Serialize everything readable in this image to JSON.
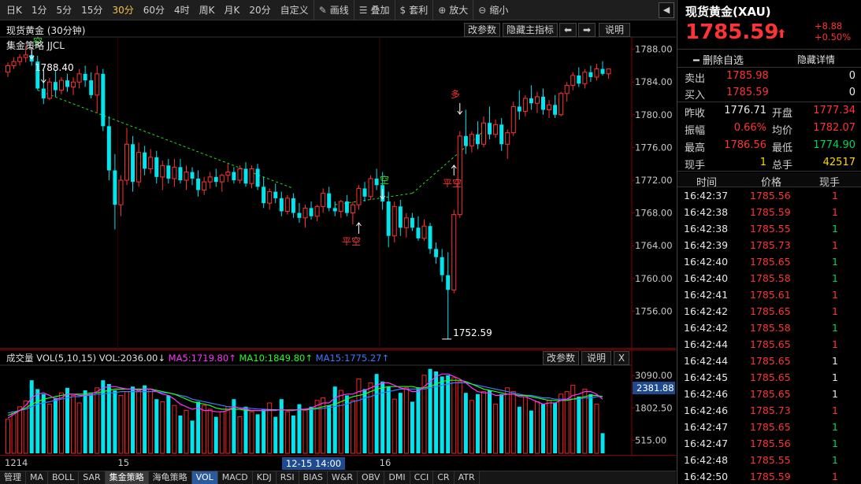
{
  "toolbar": {
    "items": [
      "日K",
      "1分",
      "5分",
      "15分",
      "30分",
      "60分",
      "4时",
      "周K",
      "月K",
      "20分",
      "自定义"
    ],
    "active": "30分",
    "tools": [
      {
        "icon": "pencil-icon",
        "glyph": "✎",
        "label": "画线"
      },
      {
        "icon": "stack-icon",
        "glyph": "☰",
        "label": "叠加"
      },
      {
        "icon": "moneybag-icon",
        "glyph": "$",
        "label": "套利"
      },
      {
        "icon": "zoom-in-icon",
        "glyph": "⊕",
        "label": "放大"
      },
      {
        "icon": "zoom-out-icon",
        "glyph": "⊖",
        "label": "缩小"
      }
    ],
    "back_glyph": "◀"
  },
  "main": {
    "title": "现货黄金 (30分钟)",
    "strategy": "集金策略 JJCL",
    "buttons": {
      "params": "改参数",
      "hide": "隐藏主指标",
      "left": "⬅",
      "right": "➡",
      "help": "说明"
    },
    "annotations": {
      "duo": "多",
      "kong": "空",
      "pingkong1": "平空",
      "pingkong2": "平空",
      "topkong": "空",
      "high_label": "1788.40",
      "low_label": "1752.59"
    }
  },
  "chart_data": {
    "type": "candlestick",
    "price_axis_ticks": [
      1788.0,
      1784.0,
      1780.0,
      1776.0,
      1772.0,
      1768.0,
      1764.0,
      1760.0,
      1756.0
    ],
    "ylim": [
      1752.0,
      1789.5
    ],
    "candles": [
      [
        1785.2,
        1786.4,
        1784.6,
        1786.0
      ],
      [
        1786.0,
        1787.0,
        1785.6,
        1786.5
      ],
      [
        1786.5,
        1787.4,
        1786.0,
        1787.0
      ],
      [
        1787.0,
        1788.4,
        1786.4,
        1787.3
      ],
      [
        1787.3,
        1787.8,
        1786.0,
        1786.5
      ],
      [
        1786.5,
        1787.2,
        1783.0,
        1783.2
      ],
      [
        1783.2,
        1784.0,
        1781.3,
        1782.0
      ],
      [
        1782.0,
        1784.5,
        1781.8,
        1784.0
      ],
      [
        1784.0,
        1785.4,
        1782.2,
        1783.0
      ],
      [
        1783.0,
        1784.6,
        1782.5,
        1784.2
      ],
      [
        1784.2,
        1785.0,
        1782.8,
        1783.4
      ],
      [
        1783.4,
        1784.6,
        1782.4,
        1784.0
      ],
      [
        1784.0,
        1785.6,
        1783.2,
        1785.0
      ],
      [
        1785.0,
        1786.0,
        1783.4,
        1784.2
      ],
      [
        1784.2,
        1785.2,
        1782.0,
        1782.4
      ],
      [
        1782.4,
        1786.0,
        1780.2,
        1785.0
      ],
      [
        1785.0,
        1785.6,
        1778.0,
        1778.6
      ],
      [
        1778.6,
        1779.8,
        1772.0,
        1773.2
      ],
      [
        1773.2,
        1775.2,
        1766.0,
        1769.0
      ],
      [
        1769.0,
        1772.6,
        1767.6,
        1772.0
      ],
      [
        1772.0,
        1778.4,
        1771.4,
        1776.4
      ],
      [
        1776.4,
        1777.4,
        1770.6,
        1771.8
      ],
      [
        1771.8,
        1776.6,
        1771.2,
        1775.4
      ],
      [
        1775.4,
        1776.2,
        1772.6,
        1773.4
      ],
      [
        1773.4,
        1775.8,
        1772.8,
        1774.8
      ],
      [
        1774.8,
        1775.6,
        1771.6,
        1772.4
      ],
      [
        1772.4,
        1774.4,
        1770.8,
        1773.8
      ],
      [
        1773.8,
        1774.6,
        1771.6,
        1772.2
      ],
      [
        1772.2,
        1774.6,
        1771.2,
        1773.6
      ],
      [
        1773.6,
        1774.6,
        1771.6,
        1772.0
      ],
      [
        1772.0,
        1773.8,
        1770.8,
        1773.0
      ],
      [
        1773.0,
        1773.6,
        1771.4,
        1772.2
      ],
      [
        1772.2,
        1773.2,
        1770.0,
        1770.8
      ],
      [
        1770.8,
        1772.4,
        1770.2,
        1771.8
      ],
      [
        1771.8,
        1773.0,
        1771.0,
        1772.4
      ],
      [
        1772.4,
        1773.4,
        1771.2,
        1771.8
      ],
      [
        1771.8,
        1772.8,
        1770.6,
        1772.6
      ],
      [
        1772.6,
        1774.0,
        1771.8,
        1773.0
      ],
      [
        1773.0,
        1773.6,
        1771.6,
        1772.0
      ],
      [
        1772.0,
        1773.8,
        1771.6,
        1773.4
      ],
      [
        1773.4,
        1774.2,
        1771.2,
        1771.6
      ],
      [
        1771.6,
        1773.8,
        1771.0,
        1773.4
      ],
      [
        1773.4,
        1774.0,
        1770.8,
        1771.2
      ],
      [
        1771.2,
        1772.4,
        1768.6,
        1769.2
      ],
      [
        1769.2,
        1771.0,
        1768.4,
        1770.6
      ],
      [
        1770.6,
        1771.6,
        1769.2,
        1769.8
      ],
      [
        1769.8,
        1770.6,
        1767.6,
        1768.2
      ],
      [
        1768.2,
        1770.2,
        1767.8,
        1769.8
      ],
      [
        1769.8,
        1770.4,
        1767.4,
        1768.0
      ],
      [
        1768.0,
        1769.2,
        1766.8,
        1767.4
      ],
      [
        1767.4,
        1769.0,
        1766.2,
        1768.6
      ],
      [
        1768.6,
        1769.4,
        1767.2,
        1767.6
      ],
      [
        1767.6,
        1769.0,
        1767.0,
        1768.8
      ],
      [
        1768.8,
        1771.0,
        1768.0,
        1770.4
      ],
      [
        1770.4,
        1771.2,
        1768.2,
        1768.6
      ],
      [
        1768.6,
        1769.4,
        1767.6,
        1768.2
      ],
      [
        1768.2,
        1769.6,
        1767.4,
        1769.4
      ],
      [
        1769.4,
        1770.2,
        1767.6,
        1768.0
      ],
      [
        1768.0,
        1769.4,
        1766.6,
        1769.0
      ],
      [
        1769.0,
        1771.4,
        1768.4,
        1771.0
      ],
      [
        1771.0,
        1771.8,
        1769.4,
        1770.0
      ],
      [
        1770.0,
        1772.6,
        1769.6,
        1772.2
      ],
      [
        1772.2,
        1773.4,
        1770.8,
        1771.4
      ],
      [
        1771.4,
        1773.0,
        1768.4,
        1769.4
      ],
      [
        1769.4,
        1770.6,
        1763.8,
        1765.2
      ],
      [
        1765.2,
        1769.4,
        1764.4,
        1768.8
      ],
      [
        1768.8,
        1769.6,
        1765.2,
        1766.2
      ],
      [
        1766.2,
        1768.0,
        1765.0,
        1767.4
      ],
      [
        1767.4,
        1768.0,
        1765.8,
        1766.2
      ],
      [
        1766.2,
        1767.6,
        1764.6,
        1764.9
      ],
      [
        1764.9,
        1767.2,
        1764.6,
        1766.4
      ],
      [
        1766.4,
        1766.8,
        1763.0,
        1763.6
      ],
      [
        1763.6,
        1764.4,
        1761.8,
        1762.6
      ],
      [
        1762.6,
        1763.6,
        1759.6,
        1760.4
      ],
      [
        1760.4,
        1763.2,
        1752.59,
        1758.6
      ],
      [
        1758.6,
        1768.4,
        1758.2,
        1767.8
      ],
      [
        1767.8,
        1778.0,
        1767.4,
        1777.4
      ],
      [
        1777.4,
        1780.6,
        1775.2,
        1776.2
      ],
      [
        1776.2,
        1778.0,
        1775.4,
        1777.6
      ],
      [
        1777.6,
        1779.2,
        1775.8,
        1776.4
      ],
      [
        1776.4,
        1779.8,
        1776.0,
        1779.0
      ],
      [
        1779.0,
        1781.0,
        1777.0,
        1777.6
      ],
      [
        1777.6,
        1779.4,
        1777.2,
        1778.8
      ],
      [
        1778.8,
        1779.6,
        1775.6,
        1776.4
      ],
      [
        1776.4,
        1778.2,
        1774.6,
        1777.8
      ],
      [
        1777.8,
        1781.6,
        1777.4,
        1781.0
      ],
      [
        1781.0,
        1783.0,
        1779.4,
        1780.4
      ],
      [
        1780.4,
        1782.4,
        1779.8,
        1782.0
      ],
      [
        1782.0,
        1783.6,
        1780.6,
        1781.4
      ],
      [
        1781.4,
        1782.8,
        1780.2,
        1782.2
      ],
      [
        1782.2,
        1783.2,
        1780.0,
        1780.6
      ],
      [
        1780.6,
        1781.8,
        1779.6,
        1781.2
      ],
      [
        1781.2,
        1782.4,
        1779.6,
        1780.0
      ],
      [
        1780.0,
        1782.8,
        1779.8,
        1782.6
      ],
      [
        1782.6,
        1784.0,
        1781.6,
        1783.6
      ],
      [
        1783.6,
        1785.2,
        1783.0,
        1784.8
      ],
      [
        1784.8,
        1785.8,
        1783.4,
        1783.8
      ],
      [
        1783.8,
        1785.6,
        1783.2,
        1785.2
      ],
      [
        1785.2,
        1786.0,
        1784.0,
        1784.6
      ],
      [
        1784.6,
        1786.2,
        1784.2,
        1785.6
      ],
      [
        1785.6,
        1786.56,
        1784.8,
        1785.0
      ],
      [
        1785.0,
        1785.6,
        1784.4,
        1785.59
      ]
    ],
    "dashed_segments": [
      [
        5,
        1783.0,
        48,
        1771.0
      ],
      [
        55,
        1769.0,
        68,
        1770.4
      ],
      [
        68,
        1770.4,
        80,
        1778.0
      ]
    ],
    "volume_axis_ticks": [
      3090.0,
      1802.5,
      515.0
    ],
    "volume_current": "2381.88",
    "volume": [
      1350,
      1650,
      1850,
      2080,
      2900,
      2550,
      2350,
      1950,
      2200,
      2400,
      2600,
      2300,
      2000,
      2500,
      2350,
      2600,
      2900,
      2750,
      2500,
      2300,
      2450,
      2650,
      2480,
      2700,
      2550,
      2150,
      2050,
      2300,
      1900,
      1500,
      1700,
      1300,
      2050,
      1900,
      1750,
      1450,
      1650,
      1850,
      2150,
      1450,
      1850,
      1650,
      1550,
      1750,
      2000,
      1450,
      2150,
      1650,
      1500,
      1950,
      1700,
      1850,
      2100,
      2200,
      1900,
      2650,
      2500,
      2300,
      2100,
      2950,
      2550,
      2800,
      3150,
      2850,
      2650,
      2150,
      2400,
      2600,
      2050,
      2600,
      3100,
      3350,
      3250,
      3050,
      3100,
      3000,
      2850,
      2400,
      2100,
      2350,
      2450,
      2500,
      1950,
      2350,
      2600,
      2450,
      1850,
      2250,
      1700,
      2050,
      1950,
      2100,
      2000,
      2350,
      2450,
      2700,
      2250,
      2550,
      2350,
      1950,
      800
    ],
    "ma5": [
      1400,
      1550,
      1700,
      1900,
      2200,
      2350,
      2400,
      2300,
      2150,
      2200,
      2350,
      2350,
      2300,
      2300,
      2350,
      2450,
      2600,
      2650,
      2650,
      2600,
      2550,
      2550,
      2500,
      2550,
      2550,
      2450,
      2350,
      2300,
      2150,
      1950,
      1850,
      1750,
      1800,
      1700,
      1700,
      1650,
      1650,
      1700,
      1850,
      1800,
      1750,
      1700,
      1700,
      1700,
      1700,
      1700,
      1750,
      1700,
      1700,
      1750,
      1750,
      1800,
      1900,
      2000,
      2000,
      2200,
      2300,
      2350,
      2350,
      2450,
      2500,
      2600,
      2700,
      2800,
      2800,
      2700,
      2600,
      2550,
      2450,
      2450,
      2650,
      2850,
      3050,
      3150,
      3150,
      3050,
      2950,
      2800,
      2600,
      2450,
      2400,
      2400,
      2300,
      2300,
      2350,
      2350,
      2250,
      2250,
      2150,
      2050,
      1950,
      2000,
      2000,
      2100,
      2150,
      2300,
      2350,
      2450,
      2450,
      2350,
      2150
    ],
    "ma10": [
      1500,
      1600,
      1700,
      1800,
      1950,
      2050,
      2150,
      2200,
      2250,
      2300,
      2350,
      2350,
      2350,
      2350,
      2400,
      2400,
      2450,
      2500,
      2550,
      2550,
      2550,
      2550,
      2550,
      2550,
      2550,
      2500,
      2450,
      2400,
      2350,
      2250,
      2150,
      2050,
      2000,
      1950,
      1900,
      1800,
      1750,
      1750,
      1750,
      1750,
      1700,
      1700,
      1700,
      1700,
      1720,
      1720,
      1720,
      1720,
      1720,
      1730,
      1740,
      1760,
      1800,
      1850,
      1900,
      1950,
      2050,
      2150,
      2250,
      2300,
      2350,
      2450,
      2550,
      2600,
      2650,
      2650,
      2650,
      2650,
      2650,
      2600,
      2600,
      2650,
      2750,
      2850,
      2900,
      2900,
      2900,
      2850,
      2750,
      2650,
      2550,
      2500,
      2450,
      2400,
      2350,
      2350,
      2300,
      2300,
      2250,
      2200,
      2150,
      2100,
      2100,
      2100,
      2100,
      2150,
      2200,
      2250,
      2300,
      2300,
      2250
    ],
    "ma15": [
      1600,
      1650,
      1700,
      1750,
      1850,
      1950,
      2000,
      2050,
      2100,
      2150,
      2200,
      2250,
      2250,
      2300,
      2300,
      2350,
      2350,
      2400,
      2400,
      2450,
      2450,
      2450,
      2450,
      2450,
      2450,
      2450,
      2400,
      2400,
      2350,
      2300,
      2250,
      2150,
      2100,
      2050,
      2000,
      1950,
      1900,
      1850,
      1850,
      1800,
      1800,
      1780,
      1760,
      1750,
      1740,
      1730,
      1720,
      1720,
      1720,
      1720,
      1730,
      1740,
      1760,
      1780,
      1820,
      1860,
      1900,
      1950,
      2050,
      2100,
      2200,
      2250,
      2350,
      2400,
      2450,
      2500,
      2550,
      2550,
      2550,
      2550,
      2550,
      2600,
      2650,
      2700,
      2750,
      2800,
      2800,
      2800,
      2750,
      2700,
      2650,
      2600,
      2550,
      2500,
      2450,
      2400,
      2350,
      2300,
      2300,
      2250,
      2200,
      2200,
      2150,
      2150,
      2150,
      2150,
      2150,
      2200,
      2200,
      2250,
      2250
    ],
    "vol_ylim": [
      0,
      3500
    ],
    "time_labels": [
      {
        "label": "1214",
        "index": 0
      },
      {
        "label": "15",
        "index": 19
      },
      {
        "label": "16",
        "index": 63
      }
    ],
    "time_cursor": "12-15 14:00"
  },
  "volume_panel": {
    "legend_prefix": "成交量 VOL(5,10,15) VOL:2036.00↓",
    "ma5": "MA5:1719.80↑",
    "ma10": "MA10:1849.80↑",
    "ma15": "MA15:1775.27↑",
    "buttons": {
      "params": "改参数",
      "help": "说明",
      "close": "X"
    }
  },
  "indicator_tabs": [
    "管理",
    "MA",
    "BOLL",
    "SAR",
    "集金策略",
    "海龟策略",
    "VOL",
    "MACD",
    "KDJ",
    "RSI",
    "BIAS",
    "W&R",
    "OBV",
    "DMI",
    "CCI",
    "CR",
    "ATR"
  ],
  "indicator_active": "VOL",
  "indicator_highlight": "集金策略",
  "quote": {
    "title": "现货黄金(XAU)",
    "price": "1785.59",
    "arrow": "⬆",
    "change": "+8.88",
    "change_pct": "+0.50%",
    "delete_label": "━ 删除自选",
    "detail_label": "隐藏详情",
    "sell_label": "卖出",
    "sell_price": "1785.98",
    "sell_vol": "0",
    "buy_label": "买入",
    "buy_price": "1785.59",
    "buy_vol": "0",
    "stats": [
      {
        "l1": "昨收",
        "v1": "1776.71",
        "c1": "white",
        "l2": "开盘",
        "v2": "1777.34",
        "c2": "red"
      },
      {
        "l1": "振幅",
        "v1": "0.66%",
        "c1": "red",
        "l2": "均价",
        "v2": "1782.07",
        "c2": "red"
      },
      {
        "l1": "最高",
        "v1": "1786.56",
        "c1": "red",
        "l2": "最低",
        "v2": "1774.90",
        "c2": "green"
      },
      {
        "l1": "现手",
        "v1": "1",
        "c1": "yellow",
        "l2": "总手",
        "v2": "42517",
        "c2": "yellow"
      }
    ],
    "ticks_header": {
      "time": "时间",
      "price": "价格",
      "vol": "现手"
    },
    "ticks": [
      {
        "time": "16:42:37",
        "price": "1785.56",
        "vol": "1",
        "vc": "red"
      },
      {
        "time": "16:42:38",
        "price": "1785.59",
        "vol": "1",
        "vc": "red"
      },
      {
        "time": "16:42:38",
        "price": "1785.55",
        "vol": "1",
        "vc": "green"
      },
      {
        "time": "16:42:39",
        "price": "1785.73",
        "vol": "1",
        "vc": "red"
      },
      {
        "time": "16:42:40",
        "price": "1785.65",
        "vol": "1",
        "vc": "green"
      },
      {
        "time": "16:42:40",
        "price": "1785.58",
        "vol": "1",
        "vc": "green"
      },
      {
        "time": "16:42:41",
        "price": "1785.61",
        "vol": "1",
        "vc": "red"
      },
      {
        "time": "16:42:42",
        "price": "1785.65",
        "vol": "1",
        "vc": "red"
      },
      {
        "time": "16:42:42",
        "price": "1785.58",
        "vol": "1",
        "vc": "green"
      },
      {
        "time": "16:42:44",
        "price": "1785.65",
        "vol": "1",
        "vc": "red"
      },
      {
        "time": "16:42:44",
        "price": "1785.65",
        "vol": "1",
        "vc": "white"
      },
      {
        "time": "16:42:45",
        "price": "1785.65",
        "vol": "1",
        "vc": "white"
      },
      {
        "time": "16:42:46",
        "price": "1785.65",
        "vol": "1",
        "vc": "white"
      },
      {
        "time": "16:42:46",
        "price": "1785.73",
        "vol": "1",
        "vc": "red"
      },
      {
        "time": "16:42:47",
        "price": "1785.65",
        "vol": "1",
        "vc": "green"
      },
      {
        "time": "16:42:47",
        "price": "1785.56",
        "vol": "1",
        "vc": "green"
      },
      {
        "time": "16:42:48",
        "price": "1785.55",
        "vol": "1",
        "vc": "green"
      },
      {
        "time": "16:42:50",
        "price": "1785.59",
        "vol": "1",
        "vc": "red"
      }
    ]
  },
  "colors": {
    "up": "#ff3333",
    "down": "#00e5ee",
    "dashed": "#22dd22",
    "ma5": "#ff33ff",
    "ma10": "#22ff22",
    "ma15": "#3a7bff",
    "vol_up": "#ff2222",
    "vol_down": "#00e5ee",
    "axis": "#8b0000"
  }
}
